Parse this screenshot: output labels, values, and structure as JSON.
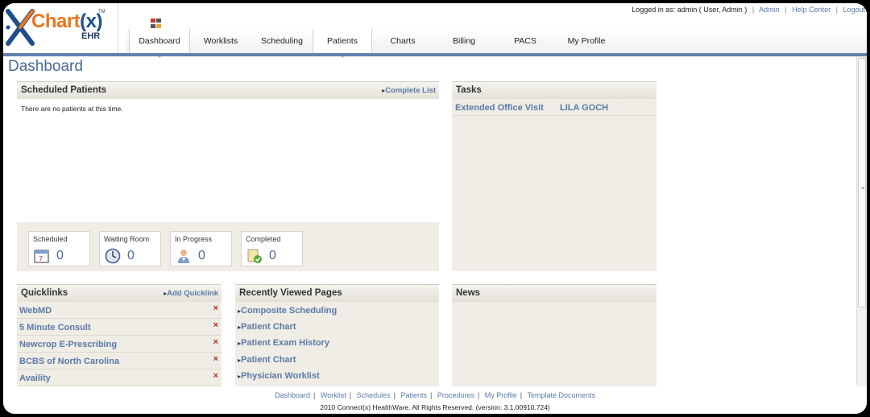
{
  "app": {
    "logo_brand": "Chart",
    "logo_brand_x": "(x)",
    "logo_sub": "EHR",
    "logo_tm": "TM"
  },
  "userbar": {
    "logged_in": "Logged in as: admin ( User, Admin )",
    "links": [
      "Admin",
      "Help Center",
      "Logout"
    ]
  },
  "tabs": [
    {
      "label": "Dashboard",
      "active": true
    },
    {
      "label": "Worklists",
      "active": false
    },
    {
      "label": "Scheduling",
      "active": false
    },
    {
      "label": "Patients",
      "active": true
    },
    {
      "label": "Charts",
      "active": false
    },
    {
      "label": "Billing",
      "active": false
    },
    {
      "label": "PACS",
      "active": false
    },
    {
      "label": "My Profile",
      "active": false
    }
  ],
  "page_title": "Dashboard",
  "scheduled": {
    "title": "Scheduled Patients",
    "link": "Complete List",
    "empty_text": "There are no patients at this time.",
    "stats": [
      {
        "label": "Scheduled",
        "value": "0",
        "icon": "calendar-icon"
      },
      {
        "label": "Waiting Room",
        "value": "0",
        "icon": "clock-icon"
      },
      {
        "label": "In Progress",
        "value": "0",
        "icon": "doctor-icon"
      },
      {
        "label": "Completed",
        "value": "0",
        "icon": "check-document-icon"
      }
    ]
  },
  "tasks": {
    "title": "Tasks",
    "rows": [
      {
        "task": "Extended Office Visit",
        "patient": "LILA GOCH"
      }
    ]
  },
  "quicklinks": {
    "title": "Quicklinks",
    "add_label": "Add Quicklink",
    "remove_glyph": "×",
    "items": [
      "WebMD",
      "5 Minute Consult",
      "Newcrop E-Prescribing",
      "BCBS of North Carolina",
      "Availity"
    ]
  },
  "recent": {
    "title": "Recently Viewed Pages",
    "items": [
      "Composite Scheduling",
      "Patient Chart",
      "Patient Exam History",
      "Patient Chart",
      "Physician Worklist"
    ]
  },
  "news": {
    "title": "News"
  },
  "footer": {
    "links": [
      "Dashboard",
      "Worklist",
      "Schedules",
      "Patients",
      "Procedures",
      "My Profile",
      "Template Documents"
    ],
    "copyright": "2010 Connect(x) HealthWare. All Rights Reserved. (version: 3.1.00910.724)"
  },
  "colors": {
    "accent_blue": "#5f82ad",
    "link_blue": "#5a79a8",
    "panel_bg": "#efede5",
    "brand_orange": "#e87722",
    "remove_red": "#b0302a"
  }
}
